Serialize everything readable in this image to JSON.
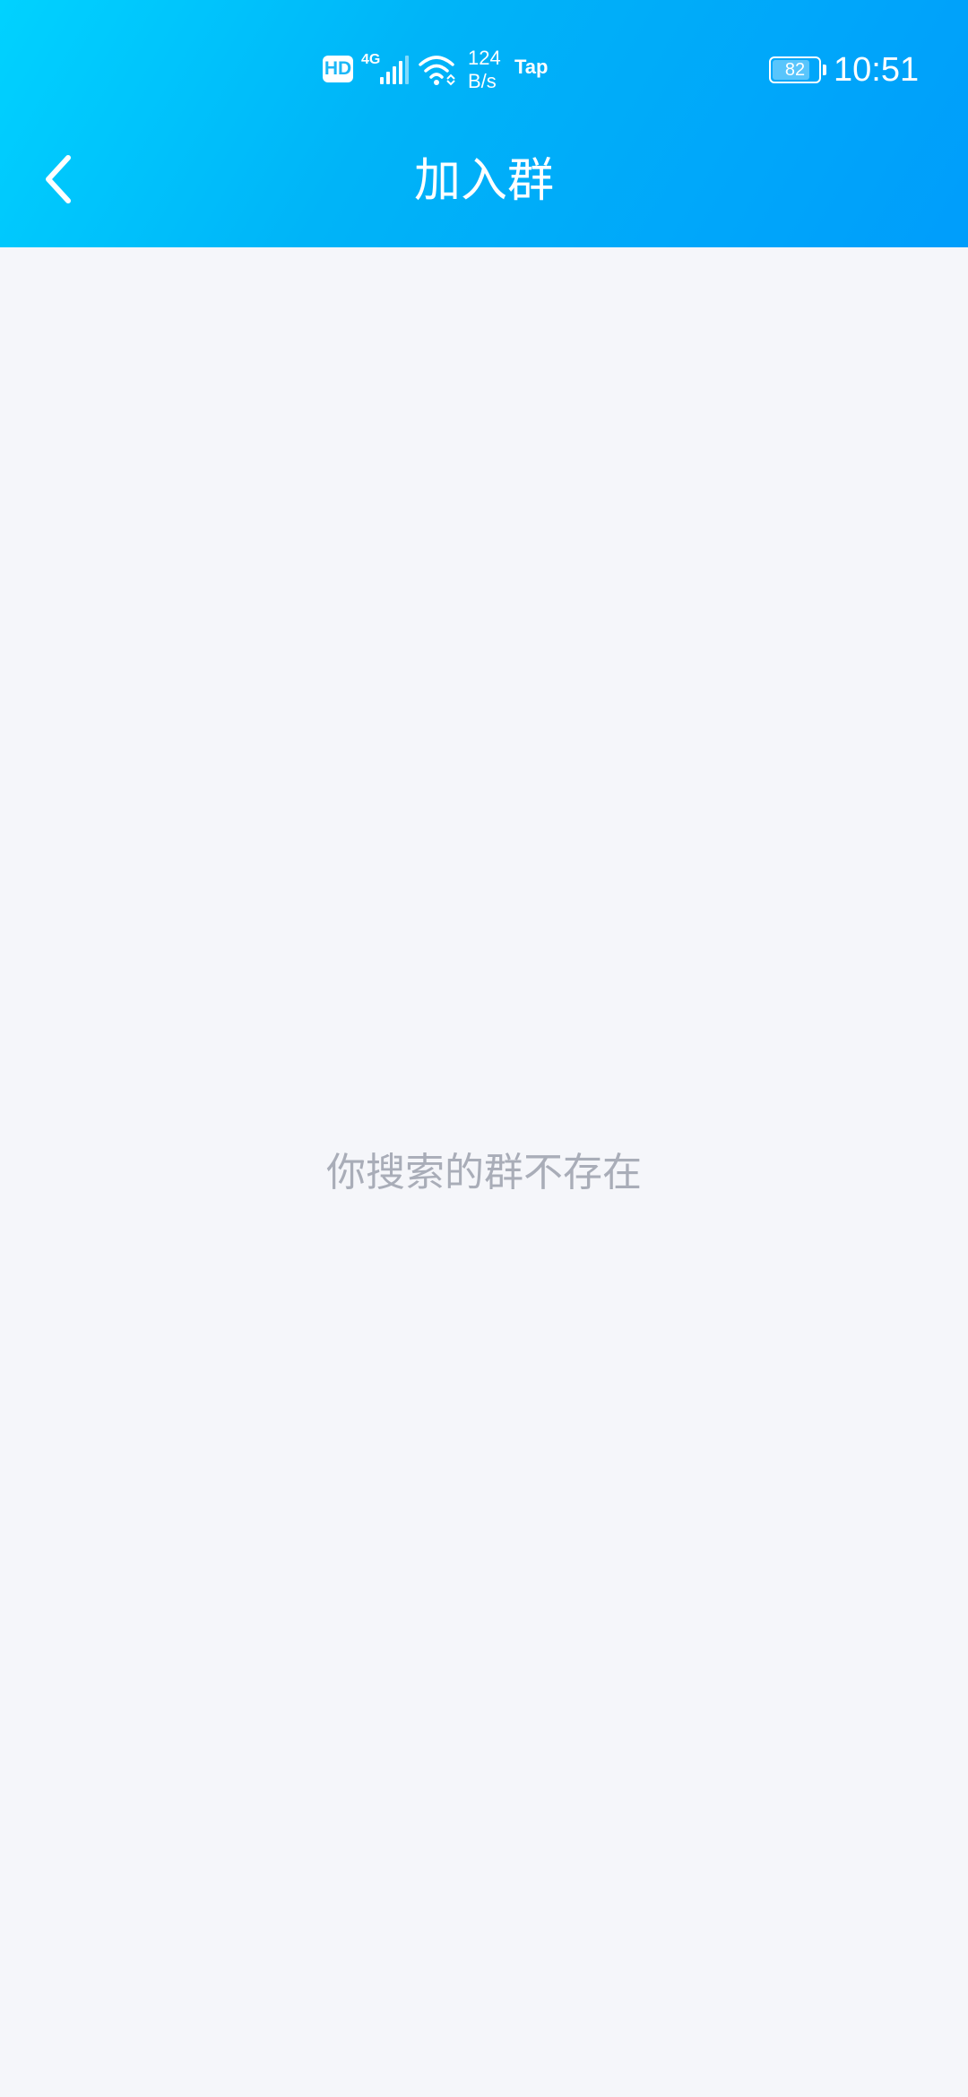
{
  "status_bar": {
    "hd_label": "HD",
    "network_type": "4G",
    "speed_value": "124",
    "speed_unit": "B/s",
    "tap_label": "Tap",
    "battery_level": "82",
    "battery_fraction": 0.82,
    "time": "10:51",
    "icons": [
      "hd-badge",
      "signal-icon",
      "wifi-icon",
      "battery-icon"
    ]
  },
  "title_bar": {
    "back_icon": "chevron-left-icon",
    "title": "加入群"
  },
  "content": {
    "empty_message": "你搜索的群不存在"
  },
  "colors": {
    "header_gradient_start": "#00d2ff",
    "header_gradient_end": "#009dfb",
    "background": "#f5f6fa",
    "empty_text": "#a9adb8"
  }
}
